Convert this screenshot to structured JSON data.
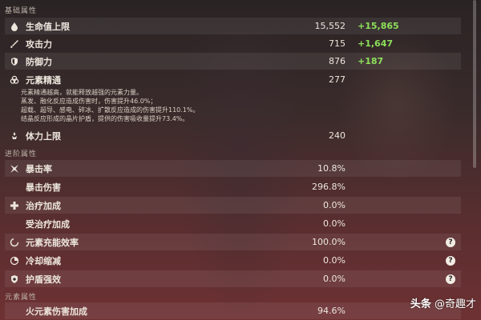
{
  "sections": {
    "base": "基础属性",
    "advanced": "进阶属性",
    "elemental": "元素属性"
  },
  "stats": {
    "hp": {
      "label": "生命值上限",
      "value": "15,552",
      "bonus": "+15,865",
      "icon": "droplet-icon"
    },
    "atk": {
      "label": "攻击力",
      "value": "715",
      "bonus": "+1,647",
      "icon": "sword-icon"
    },
    "def": {
      "label": "防御力",
      "value": "876",
      "bonus": "+187",
      "icon": "shield-icon"
    },
    "em": {
      "label": "元素精通",
      "value": "277",
      "icon": "atom-icon"
    },
    "stamina": {
      "label": "体力上限",
      "value": "240",
      "icon": "stamina-icon"
    },
    "crit_rate": {
      "label": "暴击率",
      "value": "10.8%",
      "icon": "crit-icon"
    },
    "crit_dmg": {
      "label": "暴击伤害",
      "value": "296.8%"
    },
    "heal": {
      "label": "治疗加成",
      "value": "0.0%",
      "icon": "cross-icon"
    },
    "incoming_heal": {
      "label": "受治疗加成",
      "value": "0.0%"
    },
    "er": {
      "label": "元素充能效率",
      "value": "100.0%",
      "icon": "recharge-icon",
      "help": "?"
    },
    "cdr": {
      "label": "冷却缩减",
      "value": "0.0%",
      "icon": "cooldown-icon",
      "help": "?"
    },
    "shield": {
      "label": "护盾强效",
      "value": "0.0%",
      "icon": "shield-plus-icon",
      "help": "?"
    },
    "pyro": {
      "label": "火元素伤害加成",
      "value": "94.6%"
    }
  },
  "em_description": [
    "元素精通越高，就能释放越强的元素力量。",
    "蒸发、融化反应造成伤害时，伤害提升46.0%；",
    "超载、超导、感电、碎冰、扩散反应造成的伤害提升110.1%。",
    "结晶反应形成的晶片护盾，提供的伤害吸收量提升73.4%。"
  ],
  "watermark": {
    "brand": "头条",
    "handle": "@奇趣才"
  },
  "colors": {
    "bonus": "#8de05a",
    "text": "#ece6dc"
  }
}
